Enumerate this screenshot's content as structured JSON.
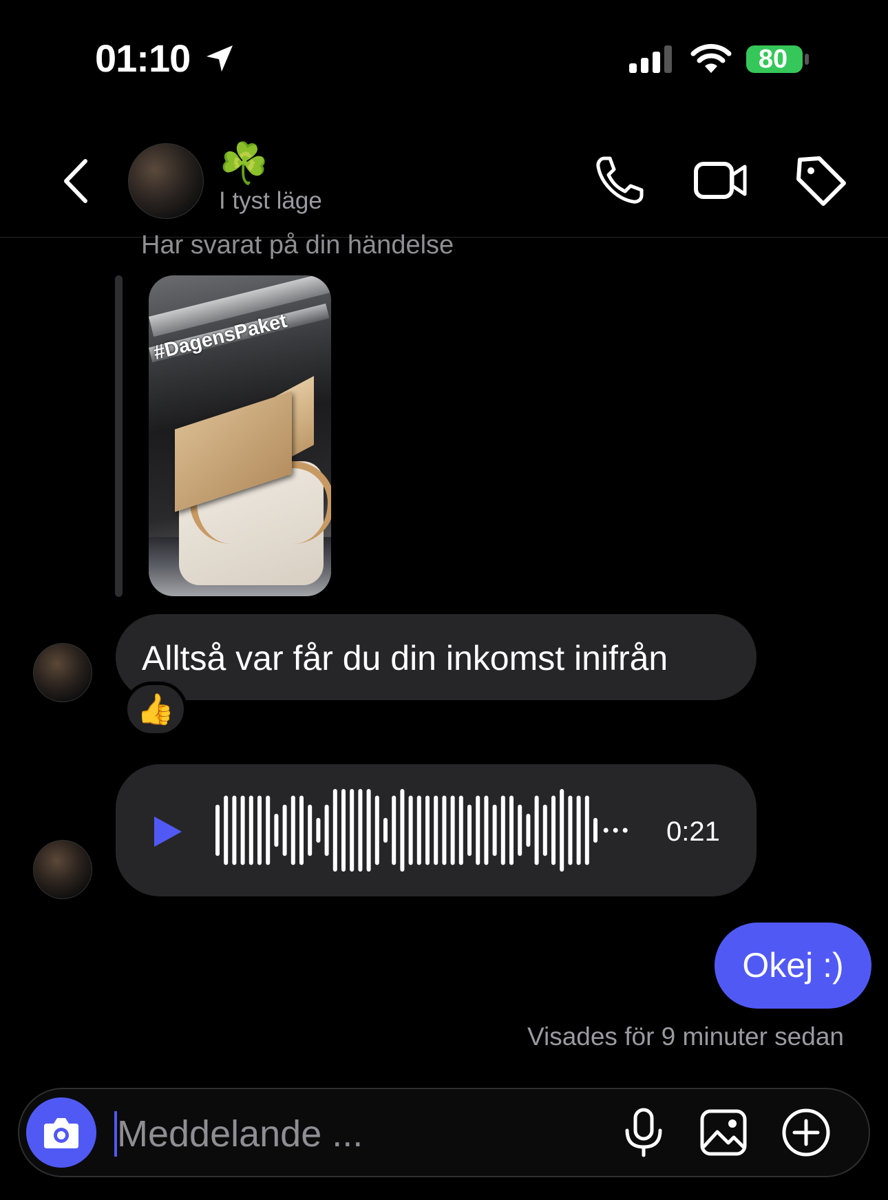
{
  "status_bar": {
    "time": "01:10",
    "battery": "80"
  },
  "header": {
    "contact_emoji": "☘️",
    "subtitle": "I tyst läge"
  },
  "thread": {
    "reply_label": "Har svarat på din händelse",
    "story_hashtag": "#DagensPaket",
    "incoming_text": "Alltså var får du din inkomst inifrån",
    "reaction": "👍",
    "voice_duration": "0:21",
    "voice_levels": [
      0.62,
      0.84,
      0.84,
      0.84,
      0.84,
      0.84,
      0.84,
      0.4,
      0.62,
      0.84,
      0.84,
      0.62,
      0.3,
      0.62,
      1.0,
      1.0,
      1.0,
      1.0,
      1.0,
      0.84,
      0.3,
      0.84,
      1.0,
      0.84,
      0.84,
      0.84,
      0.84,
      0.84,
      0.84,
      0.84,
      0.62,
      0.84,
      0.84,
      0.62,
      0.84,
      0.84,
      0.62,
      0.4,
      0.84,
      0.62,
      0.84,
      1.0,
      0.84,
      0.84,
      0.84,
      0.3
    ],
    "outgoing_text": "Okej :)",
    "seen_text": "Visades för 9 minuter sedan"
  },
  "composer": {
    "placeholder": "Meddelande ..."
  },
  "colors": {
    "accent": "#5159f5",
    "bubble": "#262628",
    "background": "#000000"
  },
  "icons": [
    "location-arrow-icon",
    "signal-icon",
    "wifi-icon",
    "battery-icon",
    "back-chevron-icon",
    "phone-icon",
    "video-camera-icon",
    "tag-icon",
    "play-icon",
    "camera-icon",
    "microphone-icon",
    "gallery-icon",
    "plus-circle-icon"
  ]
}
